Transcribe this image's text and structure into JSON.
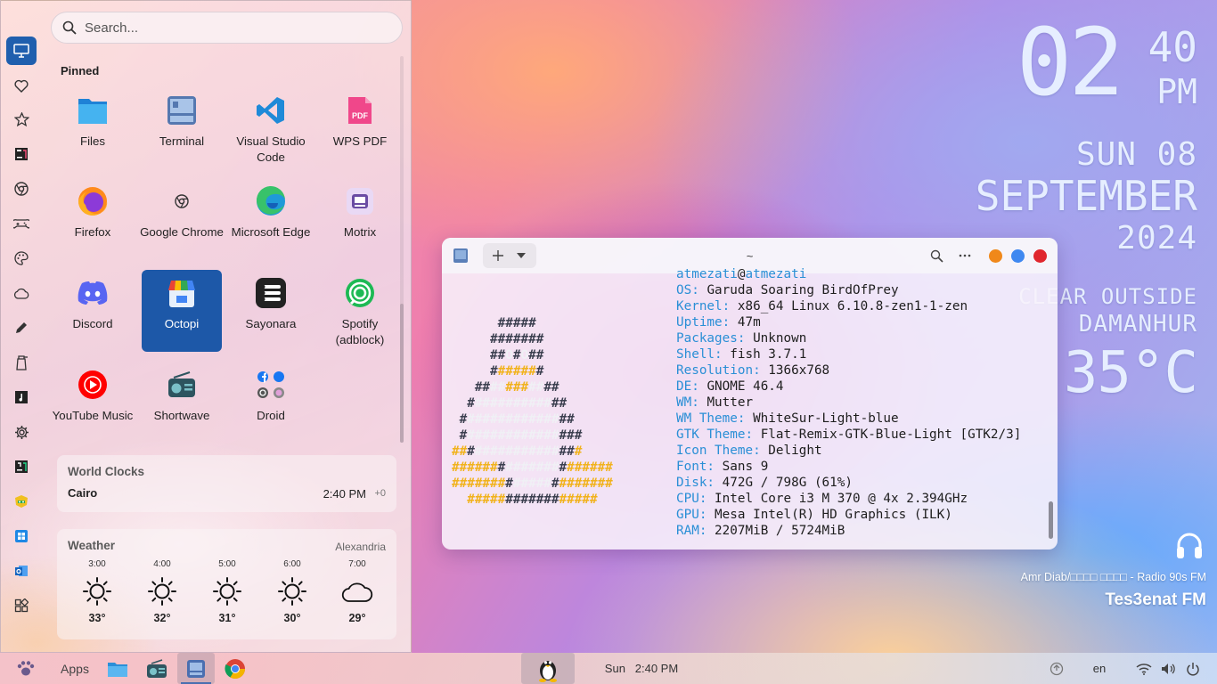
{
  "clock": {
    "hour": "02",
    "minute": "40",
    "ampm": "PM",
    "day": "SUN 08",
    "month": "SEPTEMBER",
    "year": "2024",
    "condition": "CLEAR OUTSIDE",
    "city": "DAMANHUR",
    "temperature": "35°C"
  },
  "radio": {
    "song": "Amr Diab/□□□□ □□□□ - Radio 90s FM",
    "station": "Tes3enat FM",
    "icon": "headphones-icon"
  },
  "terminal": {
    "title": "~",
    "user_line": {
      "user": "atmezati",
      "at": "@",
      "host": "atmezati"
    },
    "info": [
      {
        "key": "OS: ",
        "value": "Garuda Soaring BirdOfPrey"
      },
      {
        "key": "Kernel: ",
        "value": "x86_64 Linux 6.10.8-zen1-1-zen"
      },
      {
        "key": "Uptime: ",
        "value": "47m"
      },
      {
        "key": "Packages: ",
        "value": "Unknown"
      },
      {
        "key": "Shell: ",
        "value": "fish 3.7.1"
      },
      {
        "key": "Resolution: ",
        "value": "1366x768"
      },
      {
        "key": "DE: ",
        "value": "GNOME 46.4"
      },
      {
        "key": "WM: ",
        "value": "Mutter"
      },
      {
        "key": "WM Theme: ",
        "value": "WhiteSur-Light-blue"
      },
      {
        "key": "GTK Theme: ",
        "value": "Flat-Remix-GTK-Blue-Light [GTK2/3]"
      },
      {
        "key": "Icon Theme: ",
        "value": "Delight"
      },
      {
        "key": "Font: ",
        "value": "Sans 9"
      },
      {
        "key": "Disk: ",
        "value": "472G / 798G (61%)"
      },
      {
        "key": "CPU: ",
        "value": "Intel Core i3 M 370 @ 4x 2.394GHz"
      },
      {
        "key": "GPU: ",
        "value": "Mesa Intel(R) HD Graphics (ILK)"
      },
      {
        "key": "RAM: ",
        "value": "2207MiB / 5724MiB"
      }
    ],
    "logo_lines": [
      [
        [
          "      ",
          "d"
        ],
        [
          "#####",
          "d"
        ]
      ],
      [
        [
          "     ",
          "d"
        ],
        [
          "#######",
          "d"
        ]
      ],
      [
        [
          "     ",
          "d"
        ],
        [
          "##",
          "d"
        ],
        [
          "O",
          "w"
        ],
        [
          "#",
          "d"
        ],
        [
          "O",
          "w"
        ],
        [
          "##",
          "d"
        ]
      ],
      [
        [
          "     ",
          "d"
        ],
        [
          "#",
          "d"
        ],
        [
          "#####",
          "y"
        ],
        [
          "#",
          "d"
        ]
      ],
      [
        [
          "   ",
          "d"
        ],
        [
          "##",
          "d"
        ],
        [
          "##",
          "w"
        ],
        [
          "###",
          "y"
        ],
        [
          "##",
          "w"
        ],
        [
          "##",
          "d"
        ]
      ],
      [
        [
          "  ",
          "d"
        ],
        [
          "#",
          "d"
        ],
        [
          "##########",
          "w"
        ],
        [
          "##",
          "d"
        ]
      ],
      [
        [
          " ",
          "d"
        ],
        [
          "#",
          "d"
        ],
        [
          "############",
          "w"
        ],
        [
          "##",
          "d"
        ]
      ],
      [
        [
          " ",
          "d"
        ],
        [
          "#",
          "d"
        ],
        [
          "############",
          "w"
        ],
        [
          "###",
          "d"
        ]
      ],
      [
        [
          "",
          "d"
        ],
        [
          "##",
          "y"
        ],
        [
          "#",
          "d"
        ],
        [
          "###########",
          "w"
        ],
        [
          "##",
          "d"
        ],
        [
          "#",
          "y"
        ]
      ],
      [
        [
          "",
          "d"
        ],
        [
          "######",
          "y"
        ],
        [
          "#",
          "d"
        ],
        [
          "#######",
          "w"
        ],
        [
          "#",
          "d"
        ],
        [
          "######",
          "y"
        ]
      ],
      [
        [
          "",
          "d"
        ],
        [
          "#######",
          "y"
        ],
        [
          "#",
          "d"
        ],
        [
          "#####",
          "w"
        ],
        [
          "#",
          "d"
        ],
        [
          "#######",
          "y"
        ]
      ],
      [
        [
          "  ",
          "d"
        ],
        [
          "#####",
          "y"
        ],
        [
          "#######",
          "d"
        ],
        [
          "#####",
          "y"
        ]
      ]
    ]
  },
  "menu": {
    "search_placeholder": "Search...",
    "pinned_title": "Pinned",
    "rail_icons": [
      "desktop-icon",
      "heart-icon",
      "star-icon",
      "jetbrains-toolbox-icon",
      "chrome-icon",
      "gamepad-icon",
      "palette-icon",
      "cloud-icon",
      "pencil-icon",
      "cleaner-icon",
      "music-icon",
      "settings-icon",
      "jetbrains-icon",
      "garuda-icon",
      "windows-icon",
      "outlook-icon",
      "extensions-icon"
    ],
    "apps": [
      {
        "label": "Files",
        "icon": "files-icon"
      },
      {
        "label": "Terminal",
        "icon": "terminal-icon"
      },
      {
        "label": "Visual Studio Code",
        "icon": "vscode-icon"
      },
      {
        "label": "WPS PDF",
        "icon": "pdf-icon"
      },
      {
        "label": "Firefox",
        "icon": "firefox-icon"
      },
      {
        "label": "Google Chrome",
        "icon": "chrome-icon"
      },
      {
        "label": "Microsoft Edge",
        "icon": "edge-icon"
      },
      {
        "label": "Motrix",
        "icon": "motrix-icon"
      },
      {
        "label": "Discord",
        "icon": "discord-icon"
      },
      {
        "label": "Octopi",
        "icon": "octopi-icon"
      },
      {
        "label": "Sayonara",
        "icon": "sayonara-icon"
      },
      {
        "label": "Spotify (adblock)",
        "icon": "spotify-icon"
      },
      {
        "label": "YouTube Music",
        "icon": "youtube-music-icon"
      },
      {
        "label": "Shortwave",
        "icon": "shortwave-icon"
      },
      {
        "label": "Droid",
        "icon": "droid-icon"
      }
    ],
    "selected_app": "Octopi",
    "world_clocks": {
      "title": "World Clocks",
      "city": "Cairo",
      "time": "2:40 PM",
      "offset": "+0"
    },
    "weather": {
      "title": "Weather",
      "location": "Alexandria",
      "hours": [
        {
          "time": "3:00",
          "temp": "33°",
          "icon": "sun-icon"
        },
        {
          "time": "4:00",
          "temp": "32°",
          "icon": "sun-icon"
        },
        {
          "time": "5:00",
          "temp": "31°",
          "icon": "sun-icon"
        },
        {
          "time": "6:00",
          "temp": "30°",
          "icon": "sun-icon"
        },
        {
          "time": "7:00",
          "temp": "29°",
          "icon": "cloud-icon"
        }
      ]
    }
  },
  "taskbar": {
    "apps_label": "Apps",
    "clock": "Sun   2:40 PM",
    "language": "en",
    "icons": [
      "garuda-paw-icon",
      "files-icon",
      "shortwave-icon",
      "terminal-icon",
      "chrome-icon",
      "tux-icon",
      "update-icon",
      "wifi-icon",
      "volume-icon",
      "power-icon"
    ]
  }
}
